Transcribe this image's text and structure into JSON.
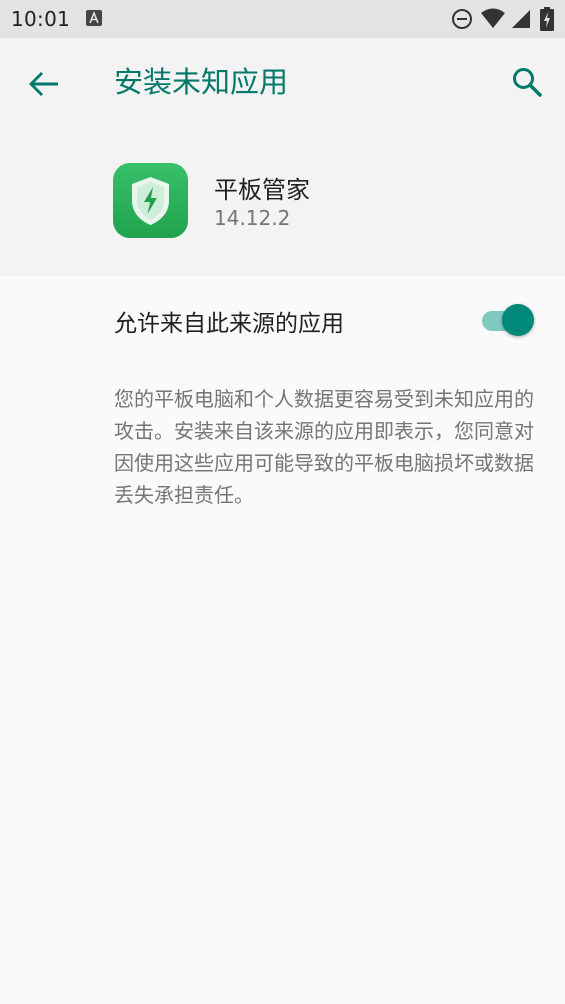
{
  "status_bar": {
    "time": "10:01",
    "icons": [
      "a-notification-icon",
      "do-not-disturb-icon",
      "wifi-icon",
      "cell-signal-icon",
      "battery-charging-icon"
    ]
  },
  "app_bar": {
    "title": "安装未知应用",
    "back_icon": "arrow-back-icon",
    "search_icon": "search-icon"
  },
  "app_info": {
    "name": "平板管家",
    "version": "14.12.2",
    "icon": "shield-lightning-icon"
  },
  "setting": {
    "label": "允许来自此来源的应用",
    "enabled": true
  },
  "description": "您的平板电脑和个人数据更容易受到未知应用的攻击。安装来自该来源的应用即表示，您同意对因使用这些应用可能导致的平板电脑损坏或数据丢失承担责任。",
  "colors": {
    "accent": "#00796b",
    "switch_thumb": "#00897b",
    "switch_track": "#80c8c0",
    "app_icon_green": "#2fb45a"
  }
}
